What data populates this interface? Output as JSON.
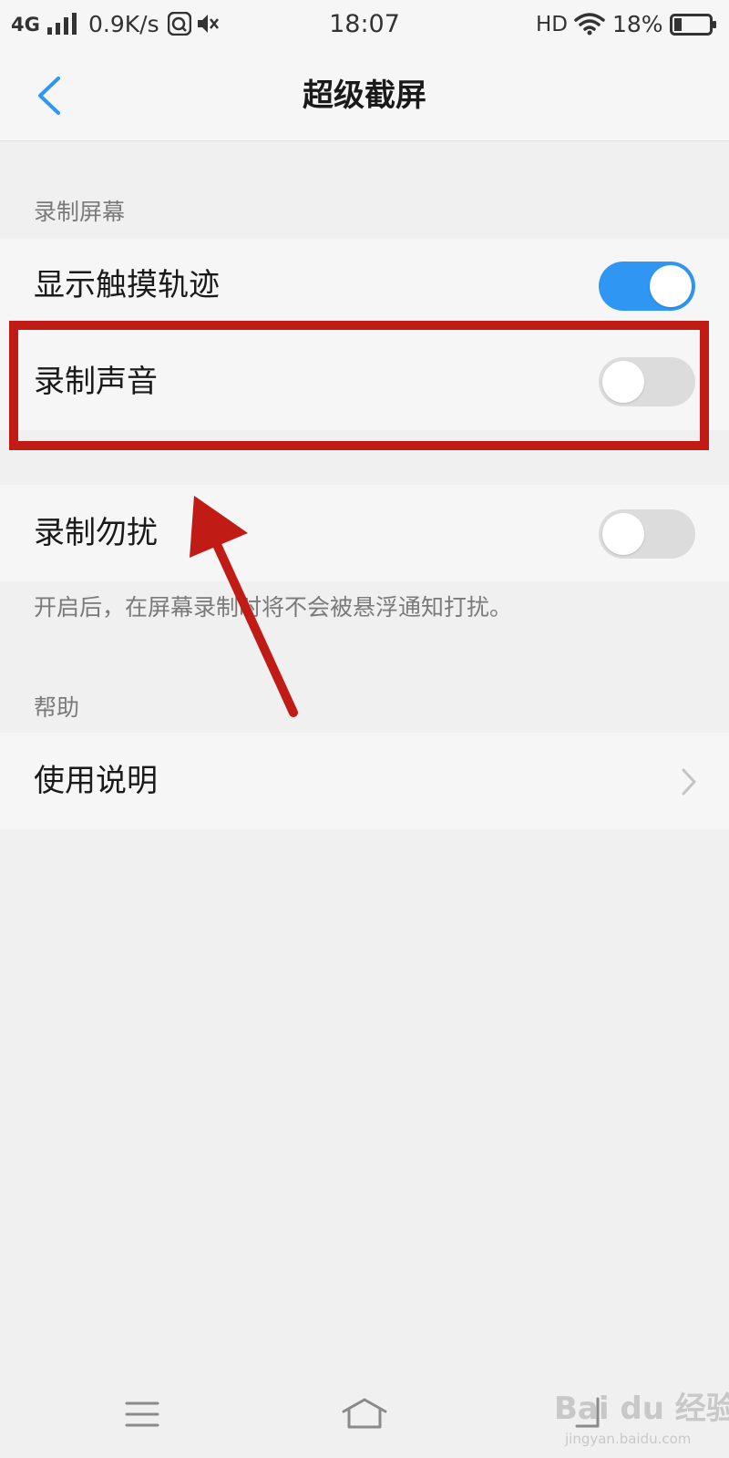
{
  "status_bar": {
    "network": "4G",
    "speed": "0.9K/s",
    "time": "18:07",
    "hd": "HD",
    "battery": "18%"
  },
  "header": {
    "title": "超级截屏"
  },
  "sections": {
    "record_screen": {
      "title": "录制屏幕",
      "items": [
        {
          "label": "显示触摸轨迹",
          "enabled": true
        },
        {
          "label": "录制声音",
          "enabled": false
        },
        {
          "label": "录制勿扰",
          "enabled": false
        }
      ],
      "hint": "开启后，在屏幕录制时将不会被悬浮通知打扰。"
    },
    "help": {
      "title": "帮助",
      "items": [
        {
          "label": "使用说明"
        }
      ]
    }
  },
  "colors": {
    "accent": "#2f96f3",
    "toggle_off": "#dcdcdc",
    "annotation": "#c01b14"
  },
  "icons": {
    "back": "chevron-left-icon",
    "more": "chevron-right-icon",
    "nav_menu": "menu-icon",
    "nav_home": "home-icon",
    "nav_recents": "recents-icon"
  },
  "watermark": {
    "text": "Bai du 经验",
    "url": "jingyan.baidu.com"
  }
}
